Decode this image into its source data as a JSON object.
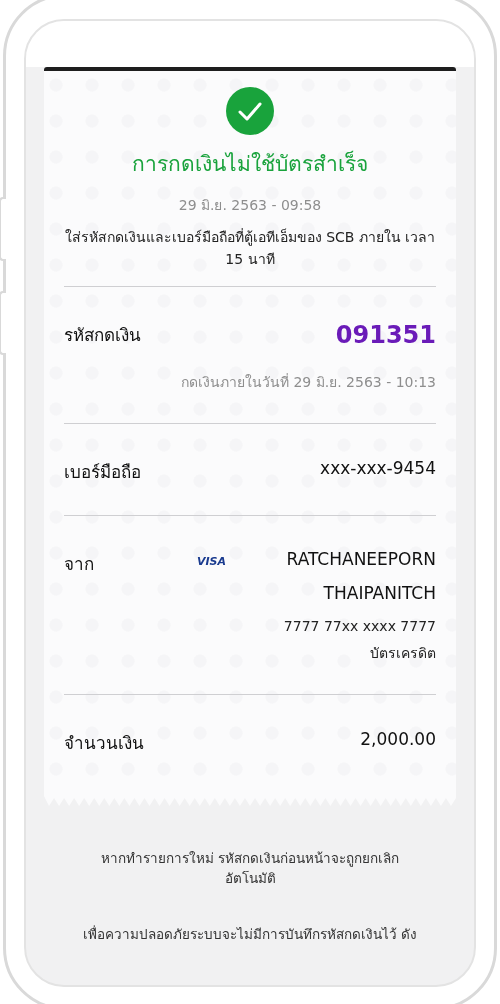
{
  "status": {
    "title": "การกดเงินไม่ใช้บัตรสำเร็จ",
    "timestamp": "29 มิ.ย. 2563 - 09:58",
    "instruction": "ใส่รหัสกดเงินและเบอร์มือถือที่ตู้เอทีเอ็มของ SCB ภายใน เวลา 15 นาที"
  },
  "rows": [
    {
      "kind": "code",
      "label": "รหัสกดเงิน",
      "value": "091351",
      "note": "กดเงินภายในวันที่ 29 มิ.ย. 2563 - 10:13"
    },
    {
      "kind": "plain",
      "label": "เบอร์มือถือ",
      "value": "xxx-xxx-9454"
    },
    {
      "kind": "card",
      "label": "จาก",
      "card_brand": "VISA",
      "name": "RATCHANEEPORN THAIPANITCH",
      "card_number": "7777 77xx xxxx 7777",
      "card_type": "บัตรเครดิต"
    },
    {
      "kind": "plain",
      "label": "จำนวนเงิน",
      "value": "2,000.00"
    }
  ],
  "footer": [
    "หากทำรายการใหม่ รหัสกดเงินก่อนหน้าจะถูกยกเลิกอัตโนมัติ",
    "เพื่อความปลอดภัยระบบจะไม่มีการบันทึกรหัสกดเงินไว้ ดัง"
  ]
}
